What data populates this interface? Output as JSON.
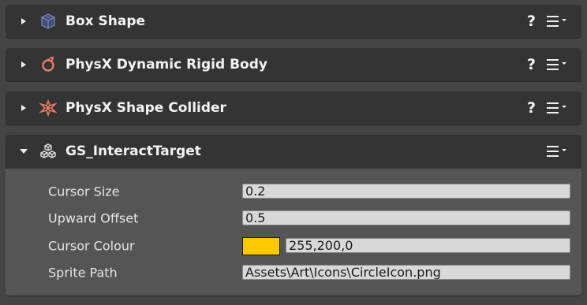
{
  "components": [
    {
      "title": "Box Shape",
      "expanded": false,
      "has_help": true,
      "icon": "box-shape-icon"
    },
    {
      "title": "PhysX Dynamic Rigid Body",
      "expanded": false,
      "has_help": true,
      "icon": "rigid-body-icon"
    },
    {
      "title": "PhysX Shape Collider",
      "expanded": false,
      "has_help": true,
      "icon": "shape-collider-icon"
    },
    {
      "title": "GS_InteractTarget",
      "expanded": true,
      "has_help": false,
      "icon": "component-cubes-icon"
    }
  ],
  "help_label": "?",
  "properties": {
    "cursor_size": {
      "label": "Cursor Size",
      "value": "0.2"
    },
    "upward_offset": {
      "label": "Upward Offset",
      "value": "0.5"
    },
    "cursor_colour": {
      "label": "Cursor Colour",
      "value": "255,200,0",
      "swatch_color": "#ffc800"
    },
    "sprite_path": {
      "label": "Sprite Path",
      "value": "Assets\\Art\\Icons\\CircleIcon.png"
    }
  },
  "colors": {
    "background": "#444444",
    "header": "#343434",
    "body": "#555555",
    "field": "#d8d8d8"
  }
}
